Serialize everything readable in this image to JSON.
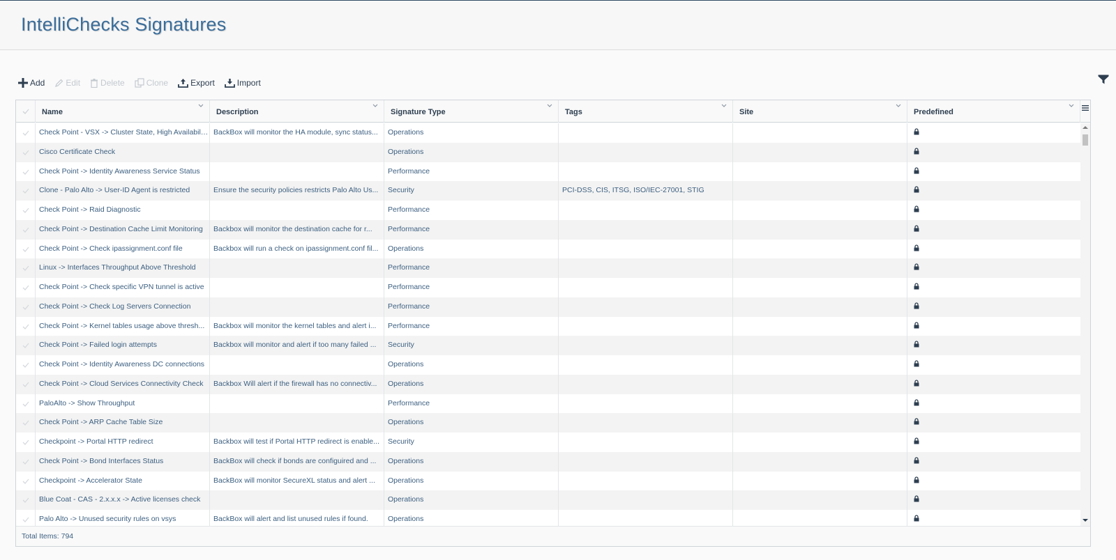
{
  "page": {
    "title": "IntelliChecks Signatures"
  },
  "toolbar": {
    "add_label": "Add",
    "edit_label": "Edit",
    "delete_label": "Delete",
    "clone_label": "Clone",
    "export_label": "Export",
    "import_label": "Import"
  },
  "table": {
    "columns": [
      "Name",
      "Description",
      "Signature Type",
      "Tags",
      "Site",
      "Predefined"
    ],
    "rows": [
      {
        "name": "Check Point - VSX -> Cluster State, High Availabilit...",
        "description": "BackBox will monitor the HA module, sync status...",
        "type": "Operations",
        "tags": "",
        "site": ""
      },
      {
        "name": "Cisco Certificate Check",
        "description": "",
        "type": "Operations",
        "tags": "",
        "site": ""
      },
      {
        "name": "Check Point -> Identity Awareness Service Status",
        "description": "",
        "type": "Performance",
        "tags": "",
        "site": ""
      },
      {
        "name": "Clone - Palo Alto -> User-ID Agent is restricted",
        "description": "Ensure the security policies restricts Palo Alto Us...",
        "type": "Security",
        "tags": "PCI-DSS, CIS, ITSG, ISO/IEC-27001, STIG",
        "site": ""
      },
      {
        "name": "Check Point -> Raid Diagnostic",
        "description": "",
        "type": "Performance",
        "tags": "",
        "site": ""
      },
      {
        "name": "Check Point -> Destination Cache Limit Monitoring",
        "description": "Backbox will monitor the destination cache for r...",
        "type": "Performance",
        "tags": "",
        "site": ""
      },
      {
        "name": "Check Point -> Check ipassignment.conf file",
        "description": "Backbox will run a check on ipassignment.conf fil...",
        "type": "Operations",
        "tags": "",
        "site": ""
      },
      {
        "name": "Linux -> Interfaces Throughput Above Threshold",
        "description": "",
        "type": "Performance",
        "tags": "",
        "site": ""
      },
      {
        "name": "Check Point -> Check specific VPN tunnel is active",
        "description": "",
        "type": "Performance",
        "tags": "",
        "site": ""
      },
      {
        "name": "Check Point -> Check Log Servers Connection",
        "description": "",
        "type": "Performance",
        "tags": "",
        "site": ""
      },
      {
        "name": "Check Point -> Kernel tables usage above thresh...",
        "description": "Backbox will monitor the kernel tables and alert i...",
        "type": "Performance",
        "tags": "",
        "site": ""
      },
      {
        "name": "Check Point -> Failed login attempts",
        "description": "Backbox will monitor and alert if too many failed ...",
        "type": "Security",
        "tags": "",
        "site": ""
      },
      {
        "name": "Check Point -> Identity Awareness DC connections",
        "description": "",
        "type": "Operations",
        "tags": "",
        "site": ""
      },
      {
        "name": "Check Point -> Cloud Services Connectivity Check",
        "description": "Backbox Will alert if the firewall has no connectiv...",
        "type": "Operations",
        "tags": "",
        "site": ""
      },
      {
        "name": "PaloAlto -> Show Throughput",
        "description": "",
        "type": "Performance",
        "tags": "",
        "site": ""
      },
      {
        "name": "Check Point -> ARP Cache Table Size",
        "description": "",
        "type": "Operations",
        "tags": "",
        "site": ""
      },
      {
        "name": "Checkpoint -> Portal HTTP redirect",
        "description": "Backbox will test if Portal HTTP redirect is enable...",
        "type": "Security",
        "tags": "",
        "site": ""
      },
      {
        "name": "Check Point -> Bond Interfaces Status",
        "description": "BackBox will check if bonds are configuired and ...",
        "type": "Operations",
        "tags": "",
        "site": ""
      },
      {
        "name": "Checkpoint -> Accelerator State",
        "description": "BackBox will monitor SecureXL status and alert ...",
        "type": "Operations",
        "tags": "",
        "site": ""
      },
      {
        "name": "Blue Coat - CAS - 2.x.x.x -> Active licenses check",
        "description": "",
        "type": "Operations",
        "tags": "",
        "site": ""
      },
      {
        "name": "Palo Alto -> Unused security rules on vsys",
        "description": "BackBox will alert and list unused rules if found.",
        "type": "Operations",
        "tags": "",
        "site": ""
      }
    ],
    "predefined_icon": "lock-icon"
  },
  "footer": {
    "total_items": "Total Items: 794"
  },
  "colors": {
    "title": "#3a6d9a",
    "row_text": "#3c5f80",
    "alt_row": "#f3f3f3",
    "frame_top": "#2e4a63"
  }
}
